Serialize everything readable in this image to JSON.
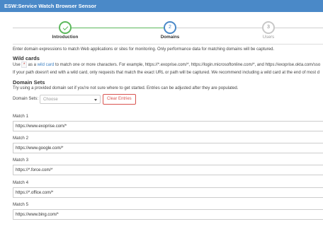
{
  "window": {
    "title": "ESW:Service Watch Browser Sensor"
  },
  "wizard": {
    "steps": [
      {
        "number": "",
        "label": "Introduction",
        "state": "done"
      },
      {
        "number": "2",
        "label": "Domains",
        "state": "active"
      },
      {
        "number": "3",
        "label": "Users",
        "state": "todo"
      }
    ]
  },
  "intro": "Enter domain expressions to match Web applications or sites for monitoring. Only performance data for matching domains will be captured.",
  "wildcards": {
    "heading": "Wild cards",
    "line1_pre": "Use ",
    "wildcard_char": "*",
    "line1_mid": " as a ",
    "line1_link": "wild card",
    "line1_post": " to match one or more characters. For example, https://*.exoprise.com/*, https://login.microsoftonline.com/*, and https://exoprise.okta.com/sso",
    "line2": "If your path doesn't end with a wild card, only requests that match the exact URL or path will be captured. We recommend including a wild card at the end of most d"
  },
  "domain_sets": {
    "heading": "Domain Sets",
    "description": "Try using a provided domain set if you're not sure where to get started. Entries can be adjusted after they are populated.",
    "label": "Domain Sets:",
    "select_placeholder": "Choose",
    "clear_button": "Clear Entries"
  },
  "matches": [
    {
      "label": "Match 1",
      "value": "https://www.exoprise.com/*"
    },
    {
      "label": "Match 2",
      "value": "https://www.google.com/*"
    },
    {
      "label": "Match 3",
      "value": "https://*.force.com/*"
    },
    {
      "label": "Match 4",
      "value": "https://*.office.com/*"
    },
    {
      "label": "Match 5",
      "value": "https://www.bing.com/*"
    }
  ],
  "colors": {
    "titlebar": "#4a89c8",
    "done": "#5cb85c",
    "active": "#4a89c8",
    "danger": "#d9534f"
  }
}
